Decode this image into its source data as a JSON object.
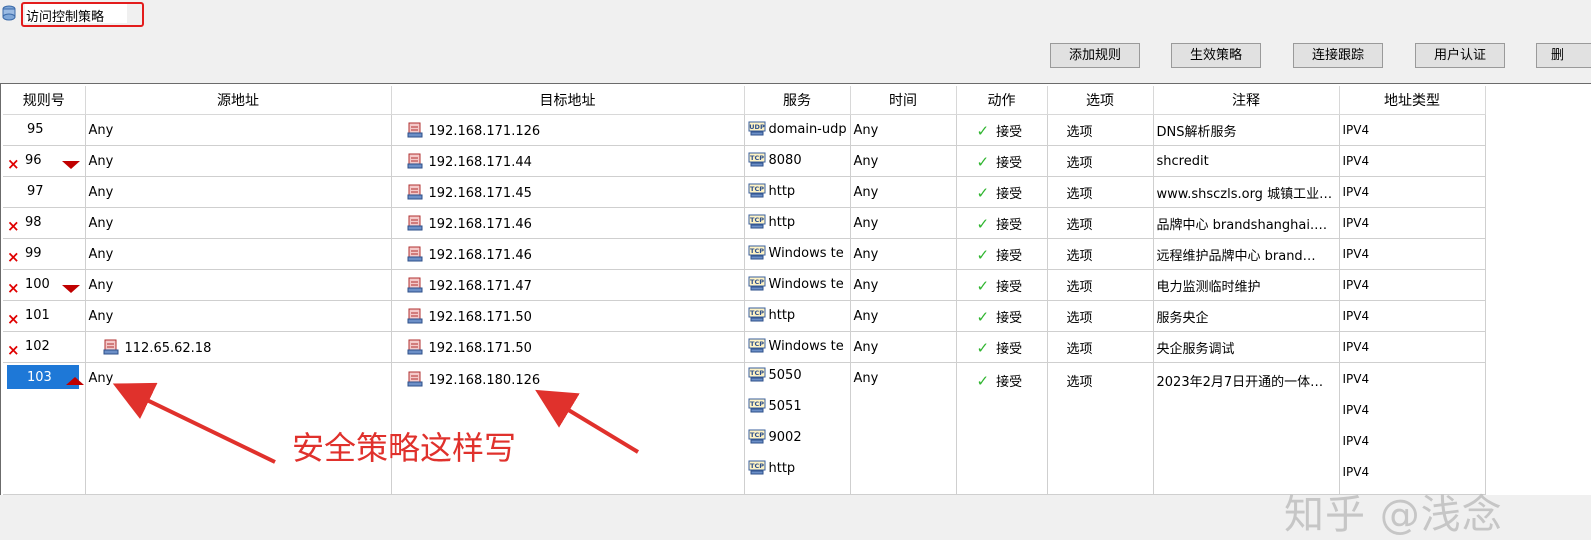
{
  "window": {
    "title": "访问控制策略",
    "icon": "policy-app-icon"
  },
  "toolbar": {
    "buttons": [
      "添加规则",
      "生效策略",
      "连接跟踪",
      "用户认证",
      "删"
    ]
  },
  "grid": {
    "columns": [
      "规则号",
      "源地址",
      "目标地址",
      "服务",
      "时间",
      "动作",
      "选项",
      "注释",
      "地址类型"
    ],
    "rows": [
      {
        "rule": "95",
        "deleted": false,
        "marker": "",
        "selected": false,
        "source": "Any",
        "source_icon": false,
        "dest": "192.168.171.126",
        "services": [
          {
            "proto": "UDP",
            "name": "domain-udp"
          }
        ],
        "time": "Any",
        "action": "接受",
        "option": "选项",
        "comment": "DNS解析服务",
        "addr_type": [
          "IPV4"
        ]
      },
      {
        "rule": "96",
        "deleted": true,
        "marker": "down",
        "selected": false,
        "source": "Any",
        "source_icon": false,
        "dest": "192.168.171.44",
        "services": [
          {
            "proto": "TCP",
            "name": "8080"
          }
        ],
        "time": "Any",
        "action": "接受",
        "option": "选项",
        "comment": "shcredit",
        "addr_type": [
          "IPV4"
        ]
      },
      {
        "rule": "97",
        "deleted": false,
        "marker": "",
        "selected": false,
        "source": "Any",
        "source_icon": false,
        "dest": "192.168.171.45",
        "services": [
          {
            "proto": "TCP",
            "name": "http"
          }
        ],
        "time": "Any",
        "action": "接受",
        "option": "选项",
        "comment": "www.shsczls.org 城镇工业…",
        "addr_type": [
          "IPV4"
        ]
      },
      {
        "rule": "98",
        "deleted": true,
        "marker": "",
        "selected": false,
        "source": "Any",
        "source_icon": false,
        "dest": "192.168.171.46",
        "services": [
          {
            "proto": "TCP",
            "name": "http"
          }
        ],
        "time": "Any",
        "action": "接受",
        "option": "选项",
        "comment": "品牌中心 brandshanghai.…",
        "addr_type": [
          "IPV4"
        ]
      },
      {
        "rule": "99",
        "deleted": true,
        "marker": "",
        "selected": false,
        "source": "Any",
        "source_icon": false,
        "dest": "192.168.171.46",
        "services": [
          {
            "proto": "TCP",
            "name": "Windows te"
          }
        ],
        "time": "Any",
        "action": "接受",
        "option": "选项",
        "comment": "远程维护品牌中心 brand…",
        "addr_type": [
          "IPV4"
        ]
      },
      {
        "rule": "100",
        "deleted": true,
        "marker": "down",
        "selected": false,
        "source": "Any",
        "source_icon": false,
        "dest": "192.168.171.47",
        "services": [
          {
            "proto": "TCP",
            "name": "Windows te"
          }
        ],
        "time": "Any",
        "action": "接受",
        "option": "选项",
        "comment": "电力监测临时维护",
        "addr_type": [
          "IPV4"
        ]
      },
      {
        "rule": "101",
        "deleted": true,
        "marker": "",
        "selected": false,
        "source": "Any",
        "source_icon": false,
        "dest": "192.168.171.50",
        "services": [
          {
            "proto": "TCP",
            "name": "http"
          }
        ],
        "time": "Any",
        "action": "接受",
        "option": "选项",
        "comment": "服务央企",
        "addr_type": [
          "IPV4"
        ]
      },
      {
        "rule": "102",
        "deleted": true,
        "marker": "",
        "selected": false,
        "source": "112.65.62.18",
        "source_icon": true,
        "dest": "192.168.171.50",
        "services": [
          {
            "proto": "TCP",
            "name": "Windows te"
          }
        ],
        "time": "Any",
        "action": "接受",
        "option": "选项",
        "comment": "央企服务调试",
        "addr_type": [
          "IPV4"
        ]
      },
      {
        "rule": "103",
        "deleted": false,
        "marker": "up",
        "selected": true,
        "source": "Any",
        "source_icon": false,
        "dest": "192.168.180.126",
        "services": [
          {
            "proto": "TCP",
            "name": "5050"
          },
          {
            "proto": "TCP",
            "name": "5051"
          },
          {
            "proto": "TCP",
            "name": "9002"
          },
          {
            "proto": "TCP",
            "name": "http"
          }
        ],
        "time": "Any",
        "action": "接受",
        "option": "选项",
        "comment": "2023年2月7日开通的一体…",
        "addr_type": [
          "IPV4",
          "IPV4",
          "IPV4",
          "IPV4"
        ]
      }
    ]
  },
  "annotation": {
    "text": "安全策略这样写",
    "color": "#e0312c"
  },
  "watermark": {
    "text": "知乎 @浅念"
  },
  "colors": {
    "selection": "#1e78d7",
    "delete_mark": "#e00000",
    "accept_check": "#2fb52f",
    "title_highlight": "#e31c1c"
  }
}
